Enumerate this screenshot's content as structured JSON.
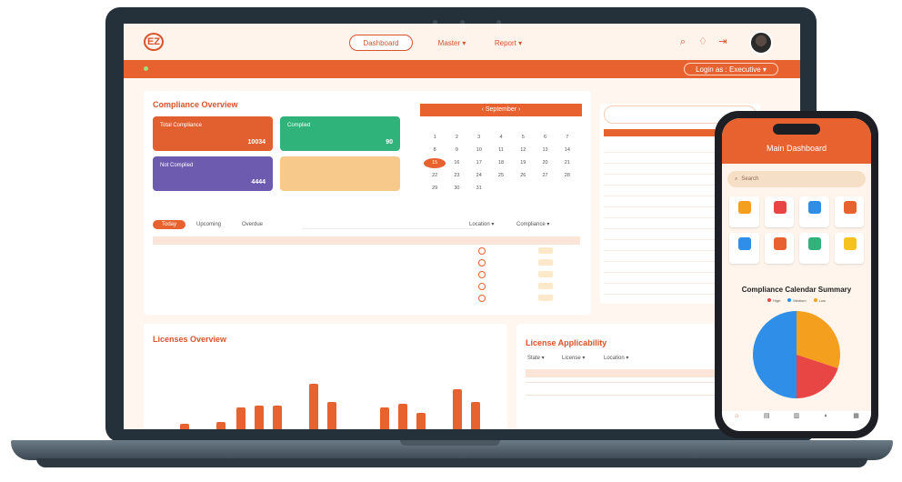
{
  "laptop": {
    "nav": {
      "logo_text": "EZ",
      "dashboard": "Dashboard",
      "master": "Master ▾",
      "report": "Report ▾"
    },
    "orangebar": {
      "login": "Login as : Executive ▾"
    },
    "overview": {
      "title": "Compliance Overview",
      "cards": [
        {
          "label": "Total Compliance",
          "value": "10034",
          "color": "#e2602f"
        },
        {
          "label": "Complied",
          "value": "90",
          "color": "#2fb37a"
        },
        {
          "label": "Not Complied",
          "value": "4444",
          "color": "#6d5bb0"
        },
        {
          "label": "",
          "value": "",
          "color": "#f7c98a"
        }
      ],
      "tabs": [
        "Today",
        "Upcoming",
        "Overdue"
      ],
      "filters": {
        "location": "Location ▾",
        "compliance": "Compliance ▾"
      }
    },
    "calendar": {
      "month": "‹ September ›",
      "selected": "15",
      "days": [
        "1",
        "2",
        "3",
        "4",
        "5",
        "6",
        "7",
        "8",
        "9",
        "10",
        "11",
        "12",
        "13",
        "14",
        "15",
        "16",
        "17",
        "18",
        "19",
        "20",
        "21",
        "22",
        "23",
        "24",
        "25",
        "26",
        "27",
        "28",
        "29",
        "30",
        "31"
      ]
    },
    "licenses": {
      "title": "Licenses Overview"
    },
    "applicability": {
      "title": "License Applicability",
      "filters": [
        "State ▾",
        "License ▾",
        "Location ▾"
      ]
    }
  },
  "phone": {
    "title": "Main Dashboard",
    "search_placeholder": "Search",
    "calendar_title": "Compliance Calendar Summary",
    "legend": [
      {
        "label": "High",
        "color": "#e84545"
      },
      {
        "label": "Medium",
        "color": "#2f8ee8"
      },
      {
        "label": "Low",
        "color": "#f59f1e"
      }
    ],
    "tile_colors": [
      "#f59f1e",
      "#e84545",
      "#2f8ee8",
      "#e8622f",
      "#2f8ee8",
      "#e8622f",
      "#2fb37a",
      "#f5c21e"
    ]
  }
}
